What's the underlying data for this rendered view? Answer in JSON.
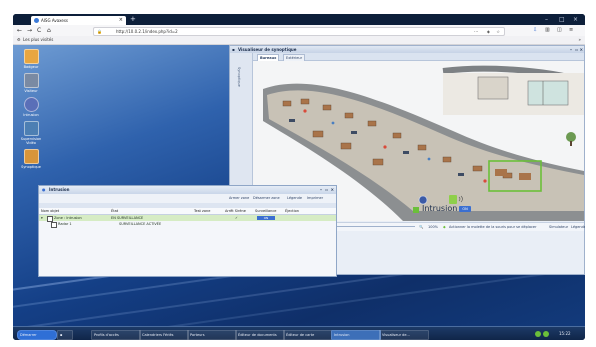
{
  "browser": {
    "tab_title": "AISG Avaxess",
    "url": "http://10.0.2.1/index.php?id=2",
    "bookmark": "Les plus visités",
    "new_tab": "+",
    "nav_back": "←",
    "nav_forward": "→",
    "nav_reload": "C",
    "nav_home": "⌂",
    "url_menu": "···",
    "overflow": "»"
  },
  "desktop_icons": [
    {
      "label": "Badgeur",
      "color": "#e8a640"
    },
    {
      "label": "Visiteur",
      "color": "#7a8aa3"
    },
    {
      "label": "Intrusion",
      "color": "#5a6fb8"
    },
    {
      "label": "Supervision Vidéo",
      "color": "#4d7fb3"
    },
    {
      "label": "Synoptique",
      "color": "#d8953a"
    }
  ],
  "synoptic": {
    "title": "Visualiseur de synoptique",
    "side_label": "Synoptique",
    "tabs": [
      "Bureaux",
      "Extérieur"
    ],
    "intrusion_label": "Intrusion",
    "intrusion_badge": "ON",
    "zoom": "100%",
    "hint": "Actionner la molette de la souris pour se déplacer",
    "simulator": "Simulateur",
    "legend": "Légende"
  },
  "intrusion": {
    "title": "Intrusion",
    "tools": [
      "Armer zone",
      "Désarmer zone",
      "Légende",
      "Imprimer"
    ],
    "columns": [
      "Nom objet",
      "État",
      "Test zone",
      "Arrêt Sirène",
      "Surveillance",
      "Éjection"
    ],
    "rows": [
      {
        "name": "Zone : Intrusion",
        "state": "EN SURVEILLANCE",
        "siren": "✓",
        "surveillance": "ON"
      },
      {
        "name": "Radar 1",
        "state": "SURVEILLANCE ACTIVÉE",
        "siren": "",
        "surveillance": ""
      }
    ]
  },
  "taskbar": {
    "start": "Démarrer",
    "items": [
      "Profils d'accès",
      "Calendriers Fériés",
      "Porteurs",
      "Éditeur de documents",
      "Éditeur de carte",
      "Intrusion",
      "Visualiseur de..."
    ],
    "clock": "15:22"
  },
  "colors": {
    "desktop": "#1a4a94",
    "accent_green": "#6bbf3a",
    "grid_highlight": "#d6ecc4",
    "badge_blue": "#3b6fd1"
  }
}
